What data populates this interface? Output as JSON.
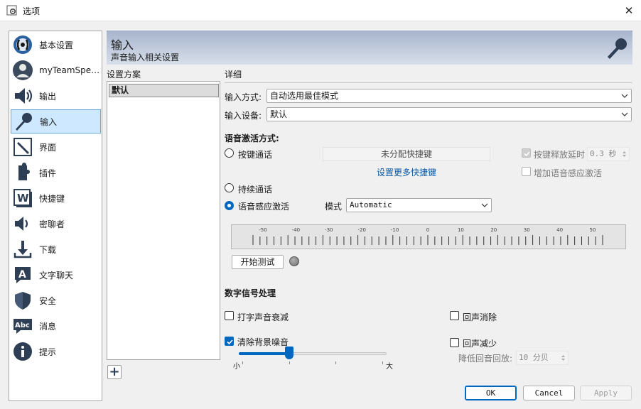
{
  "window": {
    "title": "选项",
    "close_glyph": "✕"
  },
  "nav": {
    "items": [
      {
        "label": "基本设置",
        "icon": "general-settings-icon"
      },
      {
        "label": "myTeamSpe…",
        "icon": "user-avatar-icon"
      },
      {
        "label": "输出",
        "icon": "speaker-icon"
      },
      {
        "label": "输入",
        "icon": "microphone-icon",
        "selected": true
      },
      {
        "label": "界面",
        "icon": "pen-icon"
      },
      {
        "label": "插件",
        "icon": "puzzle-piece-icon"
      },
      {
        "label": "快捷键",
        "icon": "hotkey-icon"
      },
      {
        "label": "密聊者",
        "icon": "whisper-speaker-icon"
      },
      {
        "label": "下载",
        "icon": "download-icon"
      },
      {
        "label": "文字聊天",
        "icon": "text-chat-icon"
      },
      {
        "label": "安全",
        "icon": "shield-icon"
      },
      {
        "label": "消息",
        "icon": "messages-icon"
      },
      {
        "label": "提示",
        "icon": "info-icon"
      }
    ]
  },
  "banner": {
    "title": "输入",
    "subtitle": "声音输入相关设置"
  },
  "profiles": {
    "header": "设置方案",
    "items": [
      "默认"
    ],
    "add_glyph": "+"
  },
  "details": {
    "header": "详细",
    "input_mode_label": "输入方式:",
    "input_mode_value": "自动选用最佳模式",
    "input_device_label": "输入设备:",
    "input_device_value": "默认",
    "activation_title": "语音激活方式:",
    "ptt_label": "按键通话",
    "hotkey_value": "未分配快捷键",
    "more_hotkeys_link": "设置更多快捷键",
    "release_delay_label": "按键释放延时",
    "release_delay_value": "0.3 秒",
    "vad_add_label": "增加语音感应激活",
    "continuous_label": "持续通话",
    "vad_label": "语音感应激活",
    "mode_label": "模式",
    "mode_value": "Automatic",
    "meter_ticks": [
      "-50",
      "-40",
      "-30",
      "-20",
      "-10",
      "0",
      "10",
      "20",
      "30",
      "40",
      "50"
    ],
    "test_button": "开始测试",
    "dsp_title": "数字信号处理",
    "typing_atten_label": "打字声音衰减",
    "echo_cancel_label": "回声消除",
    "denoise_label": "清除背景噪音",
    "denoise_level": 0.34,
    "slider_min_label": "小",
    "slider_max_label": "大",
    "echo_reduce_label": "回声减少",
    "echo_reduce_sub_label": "降低回音回放:",
    "echo_reduce_value": "10 分贝"
  },
  "footer": {
    "ok": "OK",
    "cancel": "Cancel",
    "apply": "Apply"
  },
  "colors": {
    "accent": "#0067c0",
    "selection": "#cde8ff",
    "link": "#0a57a4"
  }
}
